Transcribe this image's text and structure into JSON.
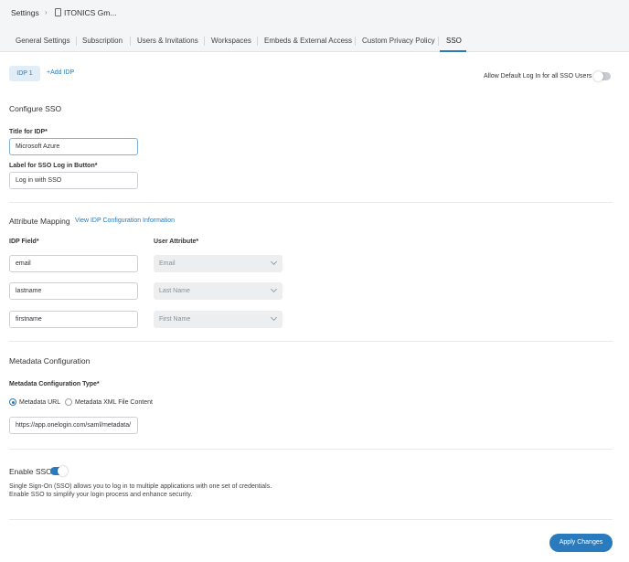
{
  "breadcrumb": {
    "settings": "Settings",
    "separator": "›",
    "org": "ITONICS Gm..."
  },
  "tabs": [
    {
      "label": "General Settings"
    },
    {
      "label": "Subscription"
    },
    {
      "label": "Users & Invitations"
    },
    {
      "label": "Workspaces"
    },
    {
      "label": "Embeds & External Access"
    },
    {
      "label": "Custom Privacy Policy"
    },
    {
      "label": "SSO",
      "active": true
    }
  ],
  "idp": {
    "tab_label": "IDP 1",
    "add_label": "+Add IDP",
    "allow_default_label": "Allow Default Log In for all SSO Users",
    "allow_default_on": false
  },
  "configure": {
    "title": "Configure SSO",
    "title_label": "Title for IDP*",
    "title_value": "Microsoft Azure",
    "button_label": "Label for SSO Log in Button*",
    "button_value": "Log in with SSO"
  },
  "mapping": {
    "title": "Attribute Mapping",
    "info_link": "View IDP Configuration Information",
    "idp_field_header": "IDP Field*",
    "user_attr_header": "User Attribute*",
    "rows": [
      {
        "field": "email",
        "attribute": "Email"
      },
      {
        "field": "lastname",
        "attribute": "Last Name"
      },
      {
        "field": "firstname",
        "attribute": "First Name"
      }
    ]
  },
  "metadata": {
    "title": "Metadata Configuration",
    "type_label": "Metadata Configuration Type*",
    "option_url": "Metadata URL",
    "option_xml": "Metadata XML File Content",
    "selected": "url",
    "url_value": "https://app.onelogin.com/saml/metadata/"
  },
  "enable": {
    "label": "Enable SSO",
    "on": true,
    "desc_line1": "Single Sign-On (SSO) allows you to log in to multiple applications with one set of credentials.",
    "desc_line2": "Enable SSO to simplify your login process and enhance security."
  },
  "footer": {
    "apply_label": "Apply Changes"
  },
  "colors": {
    "accent": "#2a7bbd",
    "header_bg": "#f4f5f6"
  }
}
